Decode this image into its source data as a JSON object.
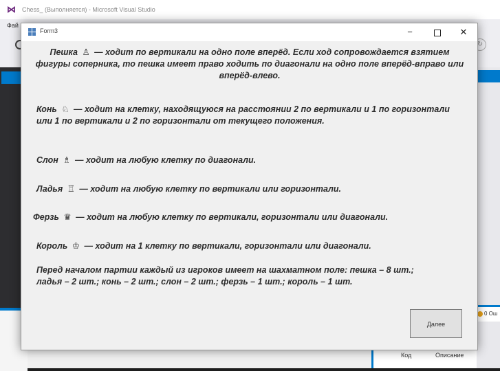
{
  "vs": {
    "title": "Chess_ (Выполняется) - Microsoft Visual Studio",
    "menu_fragment": "Фай",
    "right_tab": "0 Ош",
    "table_col1": "Код",
    "table_col2": "Описание"
  },
  "form": {
    "title": "Form3",
    "minimize_glyph": "−",
    "close_glyph": "✕",
    "next_button": "Далее"
  },
  "rules": {
    "pawn": {
      "name": "Пешка",
      "piece_glyph": "♙",
      "text": "— ходит по вертикали на одно поле вперёд. Если ход сопровождается взятием фигуры соперника, то пешка имеет право ходить по диагонали на одно поле вперёд-вправо или вперёд-влево."
    },
    "knight": {
      "name": "Конь",
      "piece_glyph": "♘",
      "text": "— ходит на клетку, находящуюся на расстоянии 2 по вертикали и 1 по горизонтали или 1 по вертикали и 2 по горизонтали от текущего положения."
    },
    "bishop": {
      "name": "Слон",
      "piece_glyph": "♗",
      "text": "— ходит на любую клетку по диагонали."
    },
    "rook": {
      "name": "Ладья",
      "piece_glyph": "♖",
      "text": "— ходит на любую клетку по вертикали или горизонтали."
    },
    "queen": {
      "name": "Ферзь",
      "piece_glyph": "♛",
      "text": "— ходит на любую клетку по вертикали, горизонтали или диагонали."
    },
    "king": {
      "name": "Король",
      "piece_glyph": "♔",
      "text": "— ходит на 1 клетку по вертикали, горизонтали или диагонали."
    },
    "setup": "Перед началом партии каждый из игроков имеет на шахматном поле: пешка – 8 шт.; ладья – 2 шт.; конь – 2 шт.; слон – 2 шт.; ферзь – 1 шт.; король – 1 шт."
  }
}
